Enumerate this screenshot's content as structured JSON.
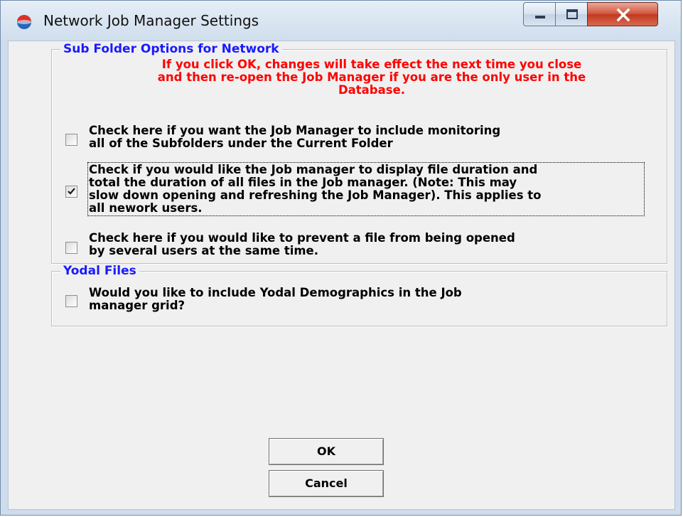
{
  "window": {
    "title": "Network Job Manager Settings",
    "icon": "app-globe-icon",
    "controls": [
      "minimize-icon",
      "maximize-icon",
      "close-icon"
    ]
  },
  "sub_folder_group": {
    "caption": "Sub Folder Options for Network",
    "warning_lines": [
      "If you click OK, changes will take effect the next time you close",
      "and then re-open the Job Manager if you are the only user in the",
      "Database."
    ],
    "options": [
      {
        "checked": false,
        "lines": [
          "Check here if you want the Job Manager to include monitoring",
          "all of the Subfolders under the Current Folder"
        ]
      },
      {
        "checked": true,
        "lines": [
          "Check if you would like the Job manager to display file duration and",
          "total the duration of all files in the Job manager. (Note: This may",
          "slow down opening and refreshing the Job Manager). This applies to",
          "all nework users."
        ]
      },
      {
        "checked": false,
        "lines": [
          "Check here if you would like to prevent a file from being opened",
          "by several users at the same time."
        ]
      }
    ]
  },
  "yodal_group": {
    "caption": "Yodal Files",
    "option": {
      "checked": false,
      "lines": [
        "Would you like to include Yodal Demographics in the Job",
        "manager grid?"
      ]
    }
  },
  "buttons": {
    "ok": "OK",
    "cancel": "Cancel"
  },
  "colors": {
    "caption": "#1a1aff",
    "warning": "#ff0000",
    "client_bg": "#f0f0f0"
  }
}
